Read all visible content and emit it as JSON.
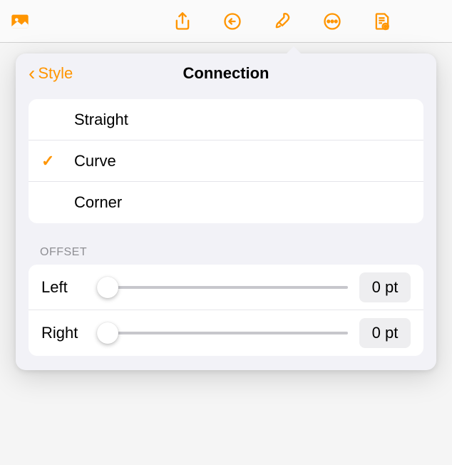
{
  "toolbar": {
    "icons": [
      "photo",
      "share",
      "undo",
      "format",
      "more",
      "document"
    ]
  },
  "popover": {
    "back_label": "Style",
    "title": "Connection",
    "options": [
      {
        "label": "Straight",
        "selected": false
      },
      {
        "label": "Curve",
        "selected": true
      },
      {
        "label": "Corner",
        "selected": false
      }
    ],
    "offset": {
      "header": "OFFSET",
      "rows": [
        {
          "label": "Left",
          "value": "0 pt",
          "position": 0
        },
        {
          "label": "Right",
          "value": "0 pt",
          "position": 0
        }
      ]
    }
  }
}
